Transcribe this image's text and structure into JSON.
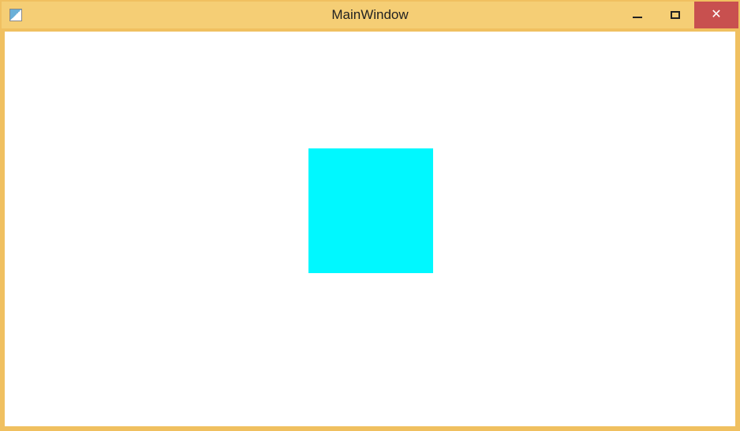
{
  "window": {
    "title": "MainWindow",
    "icon": "app-icon",
    "controls": {
      "minimize": "minimize",
      "maximize": "maximize",
      "close": "close"
    }
  },
  "content": {
    "shape_color": "#00f8ff"
  }
}
